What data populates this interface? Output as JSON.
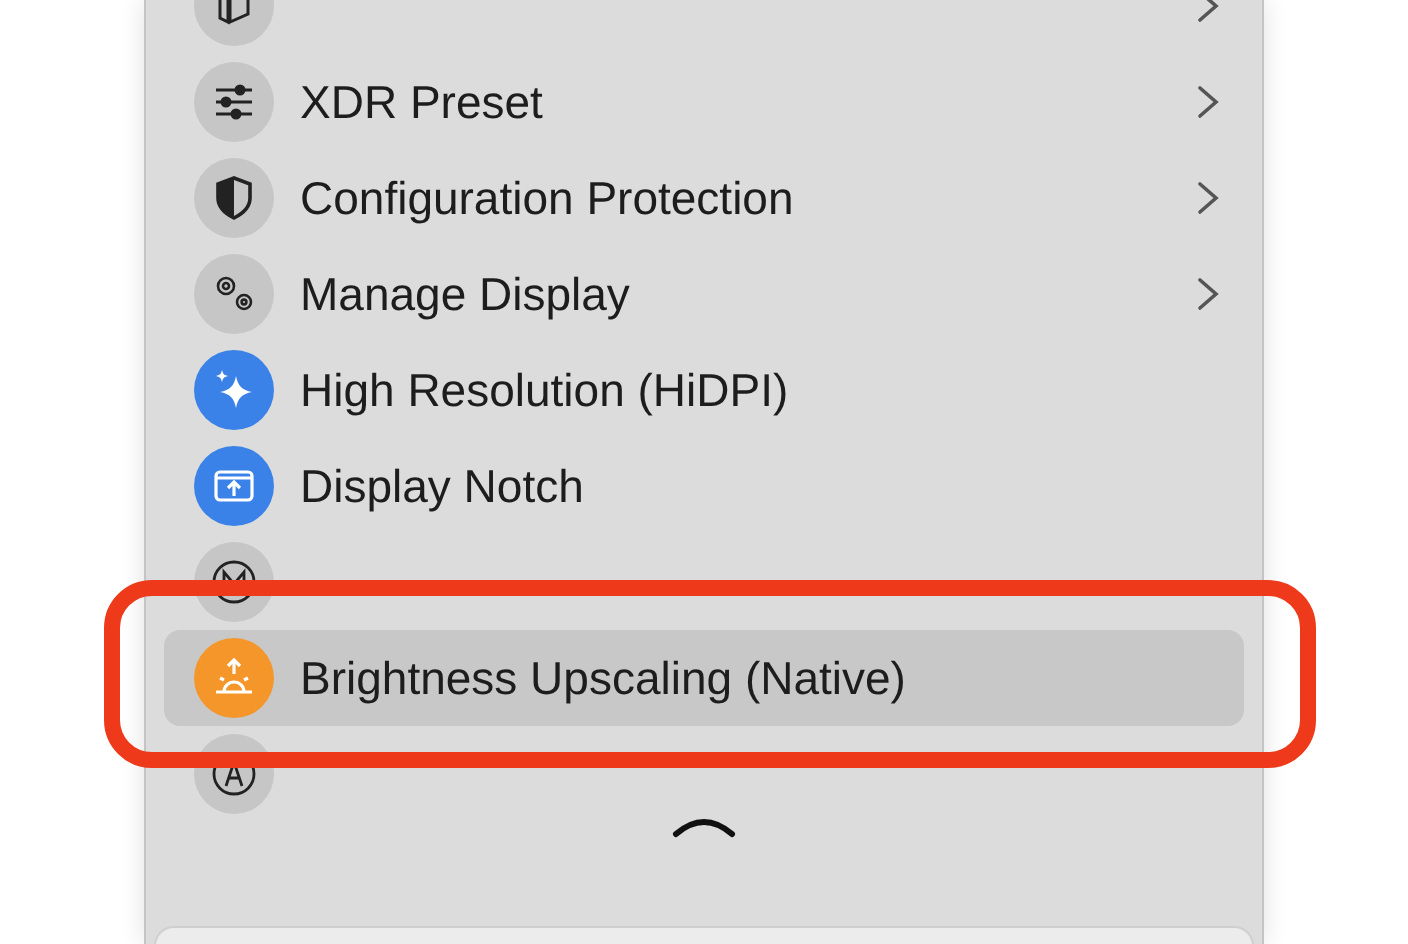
{
  "menu_items": [
    {
      "submenu": true,
      "on": false,
      "selected": false
    },
    {
      "label": "XDR Preset",
      "submenu": true,
      "on": false,
      "selected": false
    },
    {
      "label": "Configuration Protection",
      "submenu": true,
      "on": false,
      "selected": false
    },
    {
      "label": "Manage Display",
      "submenu": true,
      "on": false,
      "selected": false
    },
    {
      "label": "High Resolution (HiDPI)",
      "submenu": false,
      "on": true,
      "color": "#3b82e8",
      "selected": false
    },
    {
      "label": "Display Notch",
      "submenu": false,
      "on": true,
      "color": "#3b82e8",
      "selected": false
    },
    {
      "submenu": false,
      "on": false,
      "selected": false
    },
    {
      "label": "Brightness Upscaling (Native)",
      "submenu": false,
      "on": true,
      "color": "#f5962a",
      "selected": true
    },
    {
      "submenu": false,
      "on": false,
      "selected": false
    }
  ]
}
